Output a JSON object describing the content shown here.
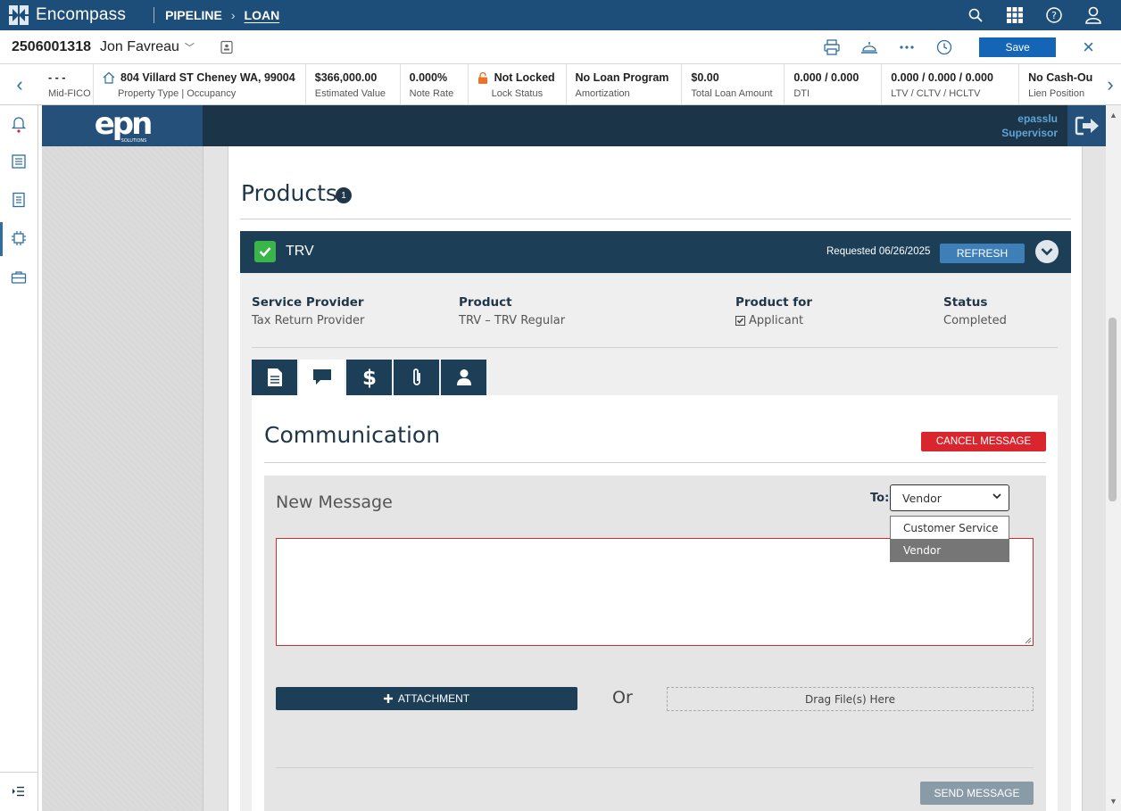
{
  "topnav": {
    "brand": "Encompass",
    "pipeline": "PIPELINE",
    "loan": "LOAN",
    "icons": [
      "search-icon",
      "apps-grid-icon",
      "help-icon",
      "user-icon"
    ]
  },
  "loan_header": {
    "loan_number": "2506001318",
    "borrower": "Jon Favreau",
    "save_label": "Save"
  },
  "summary": [
    {
      "value": "- - -",
      "label": "Mid-FICO"
    },
    {
      "value": "804 Villard ST Cheney WA, 99004",
      "label": "Property Type | Occupancy"
    },
    {
      "value": "$366,000.00",
      "label": "Estimated Value"
    },
    {
      "value": "0.000%",
      "label": "Note Rate"
    },
    {
      "value": "Not Locked",
      "label": "Lock Status"
    },
    {
      "value": "No Loan Program",
      "label": "Amortization"
    },
    {
      "value": "$0.00",
      "label": "Total Loan Amount"
    },
    {
      "value": "0.000 / 0.000",
      "label": "DTI"
    },
    {
      "value": "0.000 / 0.000 / 0.000",
      "label": "LTV / CLTV / HCLTV"
    },
    {
      "value": "No Cash-Ou",
      "label": "Lien Position"
    }
  ],
  "epn": {
    "logo": "epn",
    "logo_sub": "SOLUTIONS",
    "user": "epasslu",
    "role": "Supervisor"
  },
  "products": {
    "title": "Products",
    "count": "1",
    "item": {
      "name": "TRV",
      "requested": "Requested 06/26/2025",
      "refresh_label": "REFRESH",
      "service_provider_label": "Service Provider",
      "service_provider": "Tax Return Provider",
      "product_label": "Product",
      "product": "TRV – TRV Regular",
      "product_for_label": "Product for",
      "product_for": "Applicant",
      "status_label": "Status",
      "status": "Completed"
    }
  },
  "communication": {
    "title": "Communication",
    "cancel_label": "CANCEL MESSAGE",
    "new_message": "New Message",
    "to_label": "To:",
    "to_value": "Vendor",
    "options": [
      "Customer Service",
      "Vendor"
    ],
    "attachment_label": "ATTACHMENT",
    "or_label": "Or",
    "drag_label": "Drag File(s) Here",
    "send_label": "SEND MESSAGE"
  },
  "colors": {
    "nav": "#1d4e79",
    "product_header": "#1d3e57",
    "success": "#39b54a",
    "danger": "#d9262e",
    "primary": "#1565b7"
  }
}
